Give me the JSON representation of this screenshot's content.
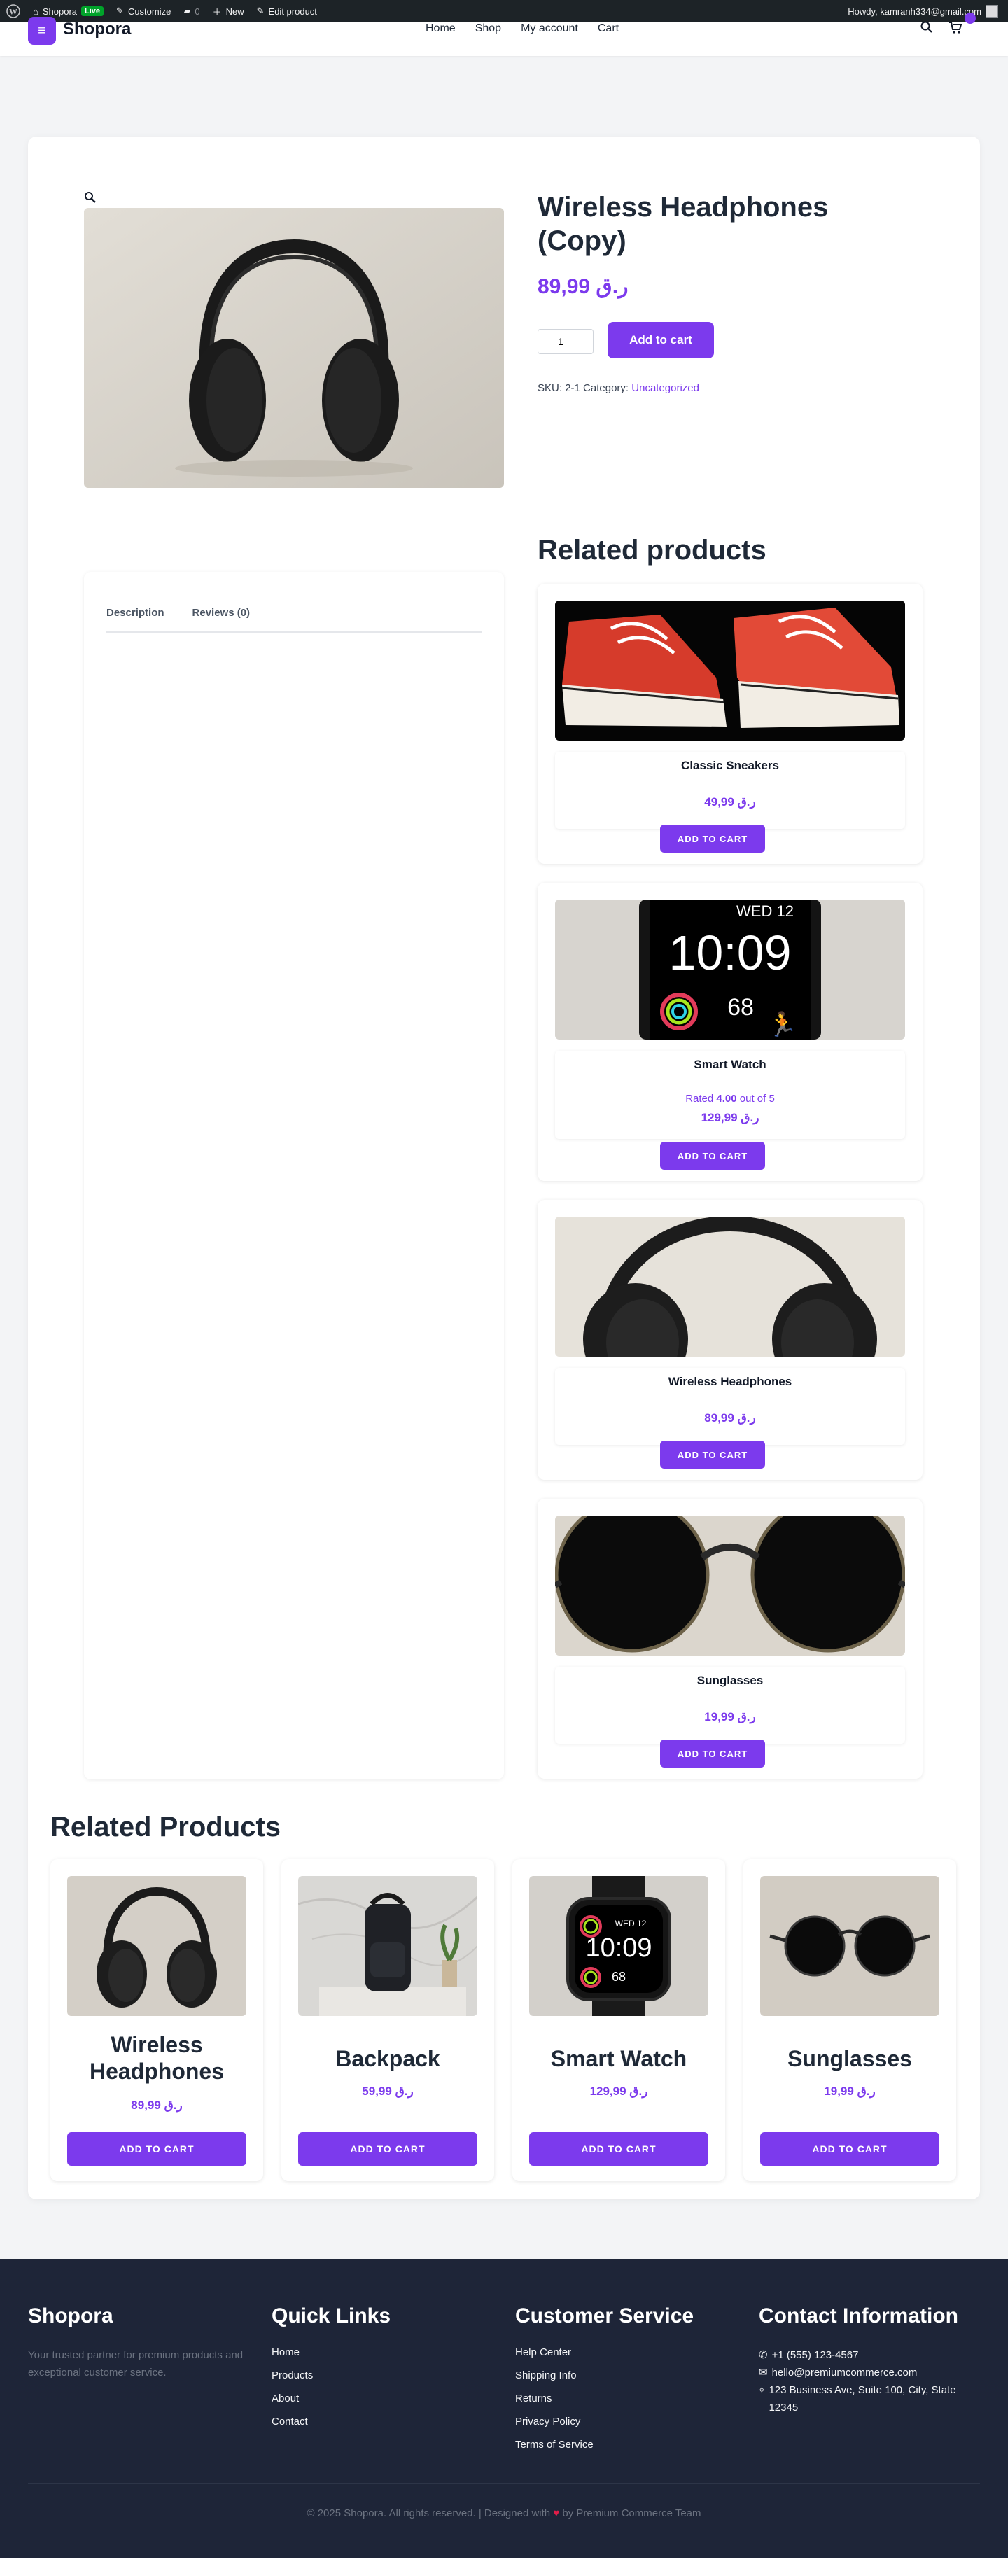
{
  "colors": {
    "accent": "#7c3aed",
    "admin_bar": "#1d2327",
    "footer": "#1e2538",
    "live_badge": "#00a32a"
  },
  "admin_bar": {
    "site_name": "Shopora",
    "live_badge": "Live",
    "customize": "Customize",
    "comments_count": "0",
    "new": "New",
    "edit_product": "Edit product",
    "howdy": "Howdy, kamranh334@gmail.com"
  },
  "header": {
    "logo_text": "Shopora",
    "nav": [
      "Home",
      "Shop",
      "My account",
      "Cart"
    ],
    "icons": [
      "menu-icon",
      "search-icon",
      "cart-icon"
    ]
  },
  "product": {
    "title": "Wireless Headphones (Copy)",
    "price": "ر.ق 89,99",
    "quantity": "1",
    "add_to_cart": "Add to cart",
    "sku_label": "SKU:",
    "sku": "2-1",
    "category_label": "Category:",
    "category": "Uncategorized",
    "tabs": [
      "Description",
      "Reviews (0)"
    ]
  },
  "related": {
    "heading": "Related products",
    "items": [
      {
        "name": "Classic Sneakers",
        "price": "ر.ق 49,99",
        "button": "ADD TO CART",
        "image": "sneakers"
      },
      {
        "name": "Smart Watch",
        "rating_prefix": "Rated ",
        "rating_value": "4.00",
        "rating_suffix": " out of 5",
        "price": "ر.ق 129,99",
        "button": "ADD TO CART",
        "image": "watch",
        "watch_date": "WED 12",
        "watch_time": "10:09",
        "watch_num": "68"
      },
      {
        "name": "Wireless Headphones",
        "price": "ر.ق 89,99",
        "button": "ADD TO CART",
        "image": "headphones"
      },
      {
        "name": "Sunglasses",
        "price": "ر.ق 19,99",
        "button": "ADD TO CART",
        "image": "sunglasses"
      }
    ]
  },
  "related_products": {
    "heading": "Related Products",
    "items": [
      {
        "name": "Wireless Headphones",
        "price": "ر.ق 89,99",
        "button": "ADD TO CART"
      },
      {
        "name": "Backpack",
        "price": "ر.ق 59,99",
        "button": "ADD TO CART"
      },
      {
        "name": "Smart Watch",
        "price": "ر.ق 129,99",
        "button": "ADD TO CART",
        "watch_date": "WED 12",
        "watch_time": "10:09",
        "watch_num": "68"
      },
      {
        "name": "Sunglasses",
        "price": "ر.ق 19,99",
        "button": "ADD TO CART"
      }
    ]
  },
  "footer": {
    "brand": "Shopora",
    "tagline": "Your trusted partner for premium products and exceptional customer service.",
    "quick_links": {
      "title": "Quick Links",
      "items": [
        "Home",
        "Products",
        "About",
        "Contact"
      ]
    },
    "customer_service": {
      "title": "Customer Service",
      "items": [
        "Help Center",
        "Shipping Info",
        "Returns",
        "Privacy Policy",
        "Terms of Service"
      ]
    },
    "contact": {
      "title": "Contact Information",
      "phone": "+1 (555) 123-4567",
      "email": "hello@premiumcommerce.com",
      "address": "123 Business Ave, Suite 100, City, State 12345"
    },
    "copyright_prefix": "© 2025 Shopora. All rights reserved. | Designed with",
    "heart": "♥",
    "copyright_suffix": "by Premium Commerce Team"
  }
}
